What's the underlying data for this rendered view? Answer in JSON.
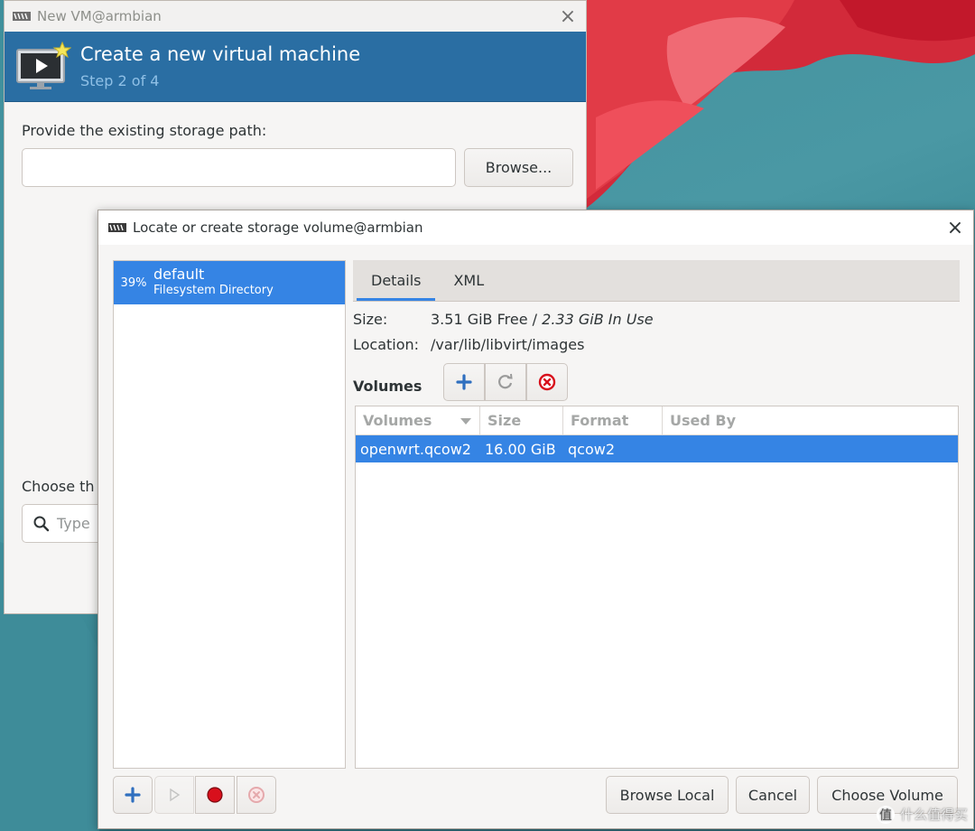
{
  "new_vm_window": {
    "title": "New VM@armbian",
    "banner_title": "Create a new virtual machine",
    "banner_step": "Step 2 of 4",
    "storage_path_label": "Provide the existing storage path:",
    "storage_path_value": "",
    "browse_label": "Browse...",
    "choose_label_partial": "Choose th",
    "search_placeholder_partial": "Type"
  },
  "storage_dialog": {
    "title": "Locate or create storage volume@armbian",
    "pools": [
      {
        "percent": "39%",
        "name": "default",
        "type": "Filesystem Directory"
      }
    ],
    "tabs": [
      "Details",
      "XML"
    ],
    "active_tab": "Details",
    "size_label": "Size:",
    "size_free": "3.51 GiB Free",
    "size_sep": " / ",
    "size_in_use": "2.33 GiB In Use",
    "location_label": "Location:",
    "location_value": "/var/lib/libvirt/images",
    "volumes_label": "Volumes",
    "volume_columns": [
      "Volumes",
      "Size",
      "Format",
      "Used By"
    ],
    "volumes": [
      {
        "name": "openwrt.qcow2",
        "size": "16.00 GiB",
        "format": "qcow2",
        "used_by": ""
      }
    ],
    "buttons": {
      "browse_local": "Browse Local",
      "cancel": "Cancel",
      "choose_volume": "Choose Volume"
    }
  },
  "watermark": {
    "text": "什么值得买",
    "icon": "值"
  },
  "colors": {
    "banner": "#2a6ea3",
    "selection": "#3584e4",
    "desktop": "#4a98a4"
  }
}
